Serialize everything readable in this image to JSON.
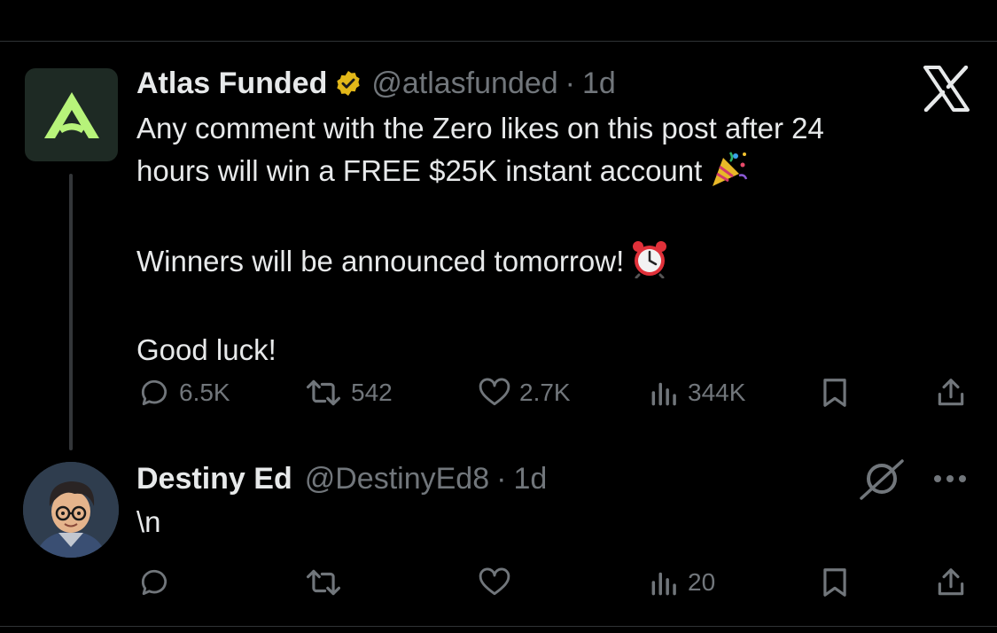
{
  "post": {
    "author_name": "Atlas Funded",
    "handle": "@atlasfunded",
    "separator": "·",
    "time": "1d",
    "lines": [
      "Any comment with the Zero likes on this post after 24",
      "hours will win a FREE $25K instant account",
      "Winners will be announced tomorrow!",
      "Good luck!"
    ],
    "emojis": [
      "party-popper-icon",
      "alarm-clock-icon"
    ],
    "stats": {
      "replies": "6.5K",
      "reposts": "542",
      "likes": "2.7K",
      "views": "344K"
    }
  },
  "reply": {
    "author_name": "Destiny Ed",
    "handle": "@DestinyEd8",
    "separator": "·",
    "time": "1d",
    "text": "\\n",
    "stats": {
      "views": "20"
    }
  },
  "colors": {
    "background": "#000000",
    "text": "#e7e9ea",
    "secondary": "#71767b",
    "verified_gold": "#e2b719",
    "atlas_green": "#b7f37a"
  }
}
